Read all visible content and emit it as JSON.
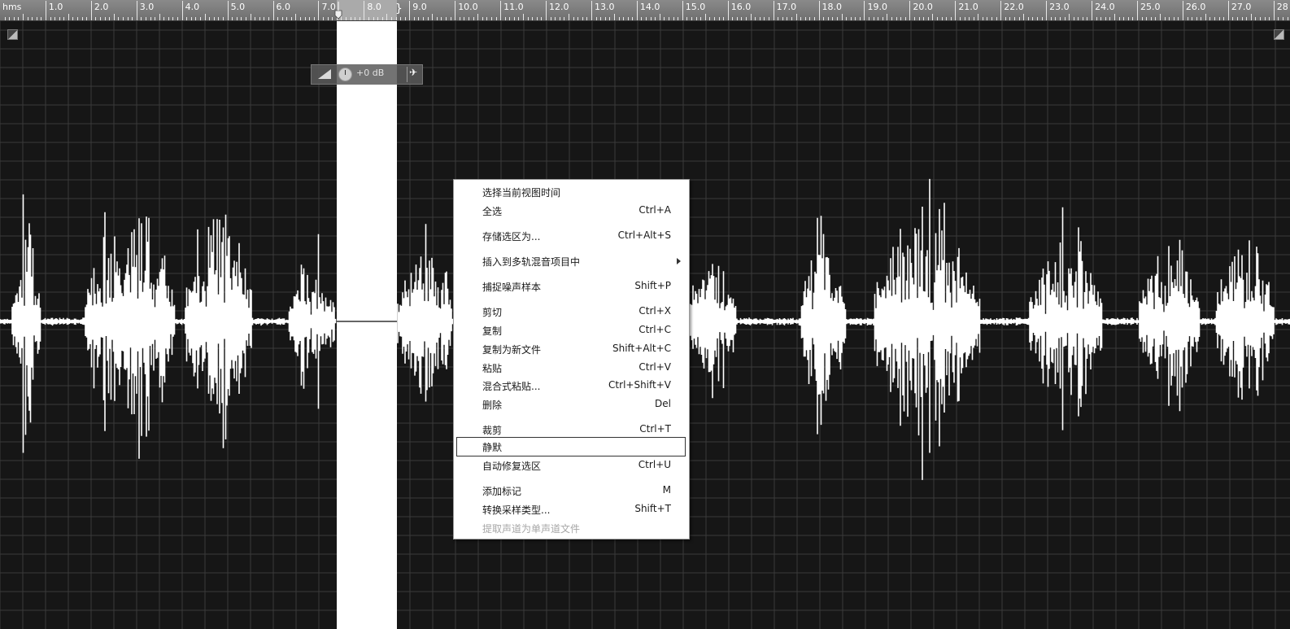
{
  "ruler": {
    "units": "hms",
    "labels": [
      "1.0",
      "2.0",
      "3.0",
      "4.0",
      "5.0",
      "6.0",
      "7.0",
      "8.0",
      "9.0",
      "10.0",
      "11.0",
      "12.0",
      "13.0",
      "14.0",
      "15.0",
      "16.0",
      "17.0",
      "18.0",
      "19.0",
      "20.0",
      "21.0",
      "22.0",
      "23.0",
      "24.0",
      "25.0",
      "26.0",
      "27.0",
      "28"
    ]
  },
  "hud": {
    "gain": "+0 dB"
  },
  "selection": {
    "start_s": 7.4,
    "end_s": 8.7
  },
  "context_menu": {
    "items": [
      {
        "label": "选择当前视图时间",
        "shortcut": ""
      },
      {
        "label": "全选",
        "shortcut": "Ctrl+A"
      },
      {
        "label": "存储选区为...",
        "shortcut": "Ctrl+Alt+S"
      },
      {
        "label": "插入到多轨混音项目中",
        "shortcut": "",
        "submenu": true
      },
      {
        "label": "捕捉噪声样本",
        "shortcut": "Shift+P"
      },
      {
        "label": "剪切",
        "shortcut": "Ctrl+X"
      },
      {
        "label": "复制",
        "shortcut": "Ctrl+C"
      },
      {
        "label": "复制为新文件",
        "shortcut": "Shift+Alt+C"
      },
      {
        "label": "粘贴",
        "shortcut": "Ctrl+V"
      },
      {
        "label": "混合式粘贴...",
        "shortcut": "Ctrl+Shift+V"
      },
      {
        "label": "删除",
        "shortcut": "Del"
      },
      {
        "label": "裁剪",
        "shortcut": "Ctrl+T"
      },
      {
        "label": "静默",
        "shortcut": "",
        "highlighted": true
      },
      {
        "label": "自动修复选区",
        "shortcut": "Ctrl+U"
      },
      {
        "label": "添加标记",
        "shortcut": "M"
      },
      {
        "label": "转换采样类型...",
        "shortcut": "Shift+T"
      },
      {
        "label": "提取声道为单声道文件",
        "shortcut": "",
        "disabled": true
      }
    ]
  }
}
